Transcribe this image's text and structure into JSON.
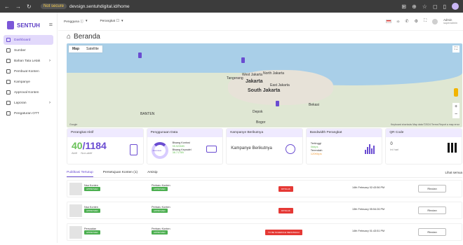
{
  "browser": {
    "security": "Not secure",
    "url": "devsign.sentuhdigital.id/home"
  },
  "app": {
    "name": "SENTUH"
  },
  "sidebar": {
    "items": [
      {
        "label": "Dashboard",
        "active": true
      },
      {
        "label": "Sumber"
      },
      {
        "label": "Bahan Tata Letak",
        "chevron": "›"
      },
      {
        "label": "Pembuat Konten"
      },
      {
        "label": "Kampanye"
      },
      {
        "label": "Approval Konten"
      },
      {
        "label": "Laporan",
        "chevron": "›"
      },
      {
        "label": "Pengaturan OTT"
      }
    ]
  },
  "topbar": {
    "dd1": "Pengguna ⓘ",
    "dd2": "Perangkat ☐",
    "user_name": "Admin",
    "user_sub": "superadmin",
    "flag_label": "ID"
  },
  "page": {
    "title": "Beranda"
  },
  "map": {
    "tab_map": "Map",
    "tab_sat": "Satellite",
    "labels": [
      "Tangerang",
      "West Jakarta",
      "North Jakarta",
      "Jakarta",
      "East Jakarta",
      "South Jakarta",
      "Bekasi",
      "Depok",
      "Bogor",
      "BANTEN"
    ],
    "footer_left": "Google",
    "footer_right": "Keyboard shortcuts   Map data ©2024   Terms   Report a map error"
  },
  "cards": {
    "aktif": {
      "title": "Perangkat Aktif",
      "value": "40",
      "total": "1184",
      "l1": "Aktif",
      "l2": "Non-aktif"
    },
    "data": {
      "title": "Penggunaan Data",
      "center": "Overview",
      "line1": "Bisang Kontosi",
      "val1": "95.923MB",
      "line2": "Bisang Keysalel",
      "val2": "38.7175B"
    },
    "kampanye": {
      "title": "Kampanye Berikutnya",
      "body": "Kampanye Berikutnya"
    },
    "bandwidth": {
      "title": "Bandwidth Perangkat",
      "l1": "Tertinggi",
      "v1": "0kbps",
      "l2": "Terendah",
      "v2": "120Kbps"
    },
    "qr": {
      "title": "QR Code",
      "l1": "0",
      "l2": "ini hari"
    }
  },
  "list": {
    "tab1": "Publikasi Tertutup",
    "tab2": "Persetujuan Konten (1)",
    "tab3": "Arsisip",
    "right": "Lihat semua",
    "rows": [
      {
        "name": "Nsa Konten",
        "badge": "APPROVED",
        "c2": "Perbaru Konten",
        "b2": "APPROVED",
        "status": "DITOLAK",
        "date": "14th February 02:43:56 PM",
        "btn": "Rincian"
      },
      {
        "name": "Nsa Konten",
        "badge": "APPROVED",
        "c2": "Perbaru Konten",
        "b2": "APPROVED",
        "status": "DITOLAK",
        "date": "13th February 05:54:26 PM",
        "btn": "Rincian"
      },
      {
        "name": "Persoalan",
        "badge": "APPROVED",
        "c2": "Perbaru Konten",
        "b2": "APPROVED",
        "status": "TO BE SCHEDULE MENUNGGU",
        "date": "14th February 01:43:51 PM",
        "btn": "Rincian"
      }
    ]
  }
}
